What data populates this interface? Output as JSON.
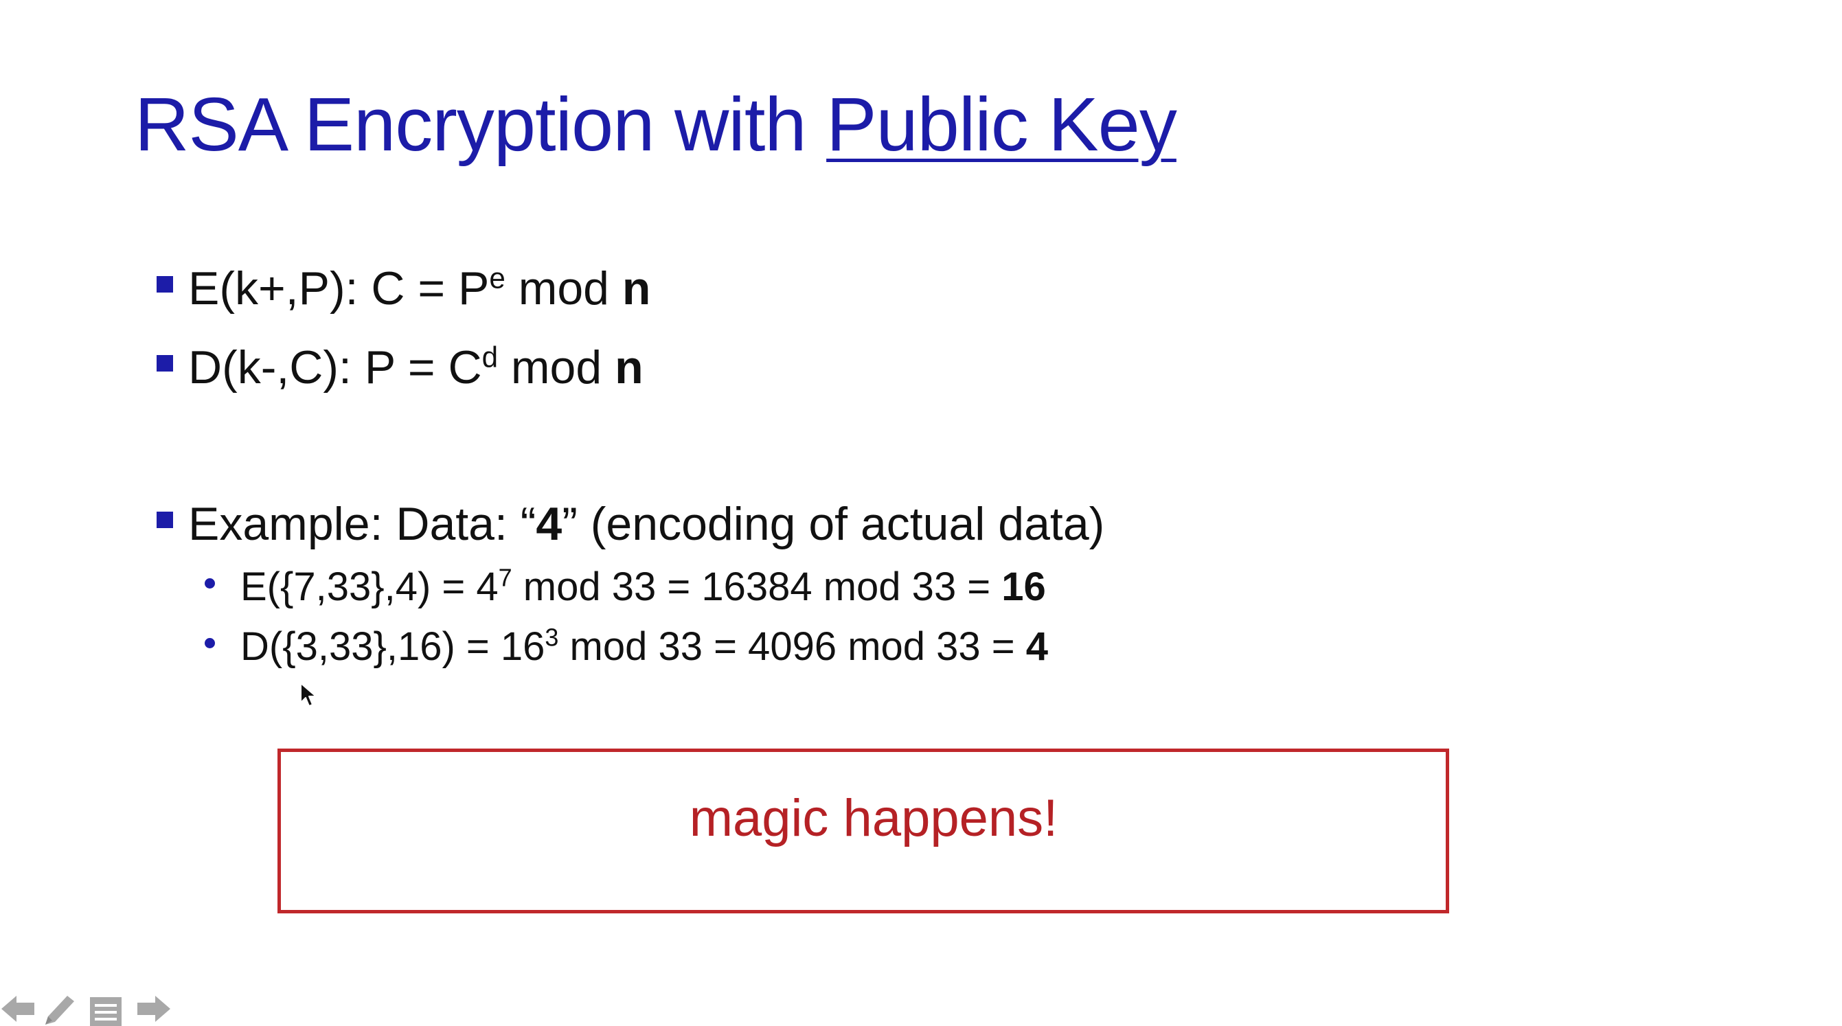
{
  "slide": {
    "title_plain": "RSA Encryption with ",
    "title_link": "Public Key",
    "bullets": [
      {
        "prefix": "E(k+,P): C = P",
        "sup": "e",
        "mid": " mod ",
        "bold": "n"
      },
      {
        "prefix": "D(k-,C): P = C",
        "sup": "d",
        "mid": " mod ",
        "bold": "n"
      }
    ],
    "example": {
      "prefix": "Example: Data: “",
      "bold": "4",
      "suffix": "” (encoding of actual data)"
    },
    "sub_bullets": [
      {
        "prefix": "E({7,33},4) = 4",
        "sup": "7",
        "mid": " mod 33 = 16384 mod 33 = ",
        "bold": "16"
      },
      {
        "prefix": "D({3,33},16) = 16",
        "sup": "3",
        "mid": " mod 33 = 4096 mod 33 = ",
        "bold": "4"
      }
    ],
    "callout": "magic happens!"
  },
  "colors": {
    "title": "#1c1ca8",
    "bullet_marker": "#1c1ca8",
    "callout_border": "#c0282b",
    "callout_text": "#b52125"
  },
  "controls": {
    "icons": [
      "arrow-left-icon",
      "pen-icon",
      "slide-menu-icon",
      "arrow-right-icon"
    ]
  }
}
